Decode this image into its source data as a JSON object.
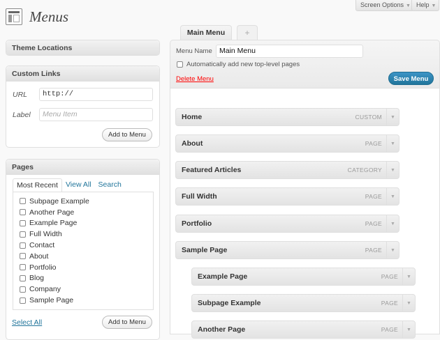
{
  "screen_options": "Screen Options",
  "help": "Help",
  "page_title": "Menus",
  "theme_locations": {
    "title": "Theme Locations"
  },
  "custom_links": {
    "title": "Custom Links",
    "url_label": "URL",
    "url_value": "http://",
    "label_label": "Label",
    "label_placeholder": "Menu Item",
    "add_button": "Add to Menu"
  },
  "pages_box": {
    "title": "Pages",
    "tabs": [
      "Most Recent",
      "View All",
      "Search"
    ],
    "items": [
      "Subpage Example",
      "Another Page",
      "Example Page",
      "Full Width",
      "Contact",
      "About",
      "Portfolio",
      "Blog",
      "Company",
      "Sample Page"
    ],
    "select_all": "Select All",
    "add_button": "Add to Menu"
  },
  "menu_tabs": {
    "active": "Main Menu",
    "add": "+"
  },
  "menu_editor": {
    "name_label": "Menu Name",
    "name_value": "Main Menu",
    "auto_add_label": "Automatically add new top-level pages",
    "delete_link": "Delete Menu",
    "save_button": "Save Menu"
  },
  "menu_items": [
    {
      "title": "Home",
      "type": "CUSTOM",
      "depth": 0
    },
    {
      "title": "About",
      "type": "PAGE",
      "depth": 0
    },
    {
      "title": "Featured Articles",
      "type": "CATEGORY",
      "depth": 0
    },
    {
      "title": "Full Width",
      "type": "PAGE",
      "depth": 0
    },
    {
      "title": "Portfolio",
      "type": "PAGE",
      "depth": 0
    },
    {
      "title": "Sample Page",
      "type": "PAGE",
      "depth": 0
    },
    {
      "title": "Example Page",
      "type": "PAGE",
      "depth": 1
    },
    {
      "title": "Subpage Example",
      "type": "PAGE",
      "depth": 1
    },
    {
      "title": "Another Page",
      "type": "PAGE",
      "depth": 1
    }
  ]
}
